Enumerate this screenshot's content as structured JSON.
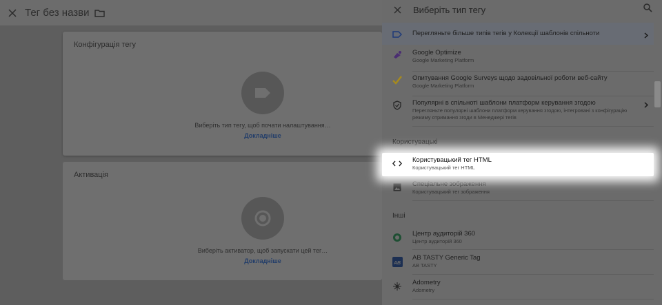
{
  "editor": {
    "title": "Тег без назви",
    "config_card": {
      "title": "Конфігурація тегу",
      "hint": "Виберіть тип тегу, щоб почати налаштування…",
      "link": "Докладніше"
    },
    "trigger_card": {
      "title": "Активація",
      "hint": "Виберіть активатор, щоб запускати цей тег…",
      "link": "Докладніше"
    }
  },
  "panel": {
    "title": "Виберіть тип тегу",
    "featured": {
      "name": "Перегляньте більше типів тегів у Колекції шаблонів спільноти"
    },
    "items_top": [
      {
        "name": "Google Optimize",
        "sub": "Google Marketing Platform"
      },
      {
        "name": "Опитування Google Surveys щодо задовільної роботи веб-сайту",
        "sub": "Google Marketing Platform"
      },
      {
        "name": "Популярні в спільноті шаблони платформ керування згодою",
        "sub": "Перегляньте популярні шаблони платформ керування згодою, інтегровані з конфігурацію режиму отримання згоди в Менеджері тегів"
      }
    ],
    "custom_section": "Користувацькі",
    "custom_items": [
      {
        "name": "Користувацький тег HTML",
        "sub": "Користувацький тег HTML"
      },
      {
        "name": "Спеціальне зображення",
        "sub": "Користувацький тег зображення"
      }
    ],
    "other_section": "Інші",
    "other_items": [
      {
        "name": "Центр аудиторій 360",
        "sub": "Центр аудиторій 360"
      },
      {
        "name": "AB TASTY Generic Tag",
        "sub": "AB TASTY"
      },
      {
        "name": "Adometry",
        "sub": "Adometry"
      }
    ]
  }
}
